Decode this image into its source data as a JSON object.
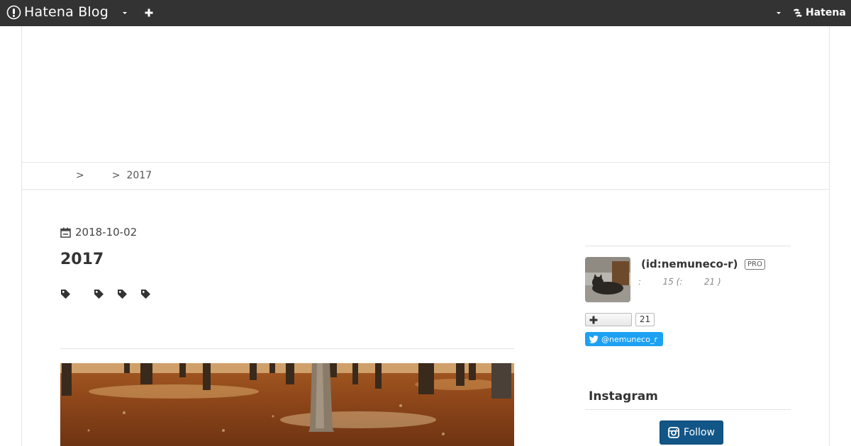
{
  "globalbar": {
    "brand": "Hatena Blog",
    "right_brand": "Hatena",
    "icons": [
      "hatena-blog-logo-icon",
      "chevron-down-icon",
      "plus-icon",
      "chevron-down-icon",
      "hatena-logo-icon"
    ]
  },
  "breadcrumb": {
    "items": [
      "",
      "",
      "2017"
    ],
    "separator": ">"
  },
  "entry": {
    "date": "2018-10-02",
    "title": "2017",
    "tag_count": 4
  },
  "sidebar": {
    "profile": {
      "id_label": "(id:nemuneco-r)",
      "badge": "PRO",
      "sub_text": ":        15 (:        21 )"
    },
    "follow": {
      "count": "21"
    },
    "twitter": {
      "handle": "@nemuneco_r"
    },
    "instagram": {
      "title": "Instagram",
      "button_label": "Follow"
    }
  },
  "colors": {
    "globalbar_bg": "#333333",
    "link": "#2a73b8",
    "twitter": "#1da1f2",
    "instagram": "#125688"
  }
}
